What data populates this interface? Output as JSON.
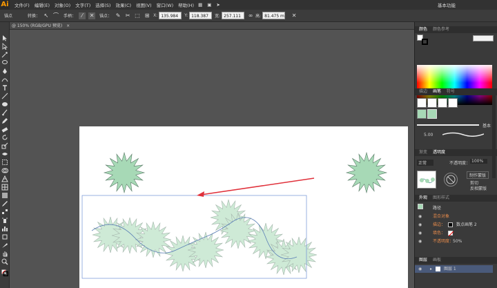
{
  "app": {
    "logo": "Ai"
  },
  "menu": [
    "文件(F)",
    "编辑(E)",
    "对象(O)",
    "文字(T)",
    "选择(S)",
    "效果(C)",
    "视图(V)",
    "窗口(W)",
    "帮助(H)"
  ],
  "workspace_label": "基本功能",
  "control_bar": {
    "label_left": "锚点",
    "convert_label": "转换：",
    "handle_label": "手柄：",
    "anchor_label": "锚点：",
    "x_value": "135.984 m",
    "y_value": "118.387 m",
    "w_value": "257.111 m",
    "h_value": "81.475 m"
  },
  "document_tab": {
    "title": "@ 150% (RGB/GPU 预览)",
    "close": "×"
  },
  "right_panel": {
    "color_tabs": [
      "颜色",
      "颜色参考"
    ],
    "brush_tabs": [
      "描边",
      "画笔",
      "符号"
    ],
    "brush_label": "基本",
    "brush_size": "5.00",
    "transparency_tabs": [
      "渐变",
      "透明度"
    ],
    "blend_mode": "正常",
    "opacity_label": "不透明度：",
    "opacity_value": "100%",
    "mask_button": "制作蒙版",
    "clip_label": "剪切",
    "invert_label": "反相蒙版",
    "appearance_tabs": [
      "外观",
      "图形样式"
    ],
    "appearance_title": "路径",
    "appearance_rows": [
      "混合对象",
      "描边：",
      "填色：",
      "不透明度："
    ],
    "stroke_value": "数点画笔 2",
    "opacity_row_value": "50%",
    "layers_tabs": [
      "图层",
      "画板"
    ],
    "layer_name": "图层 1"
  }
}
